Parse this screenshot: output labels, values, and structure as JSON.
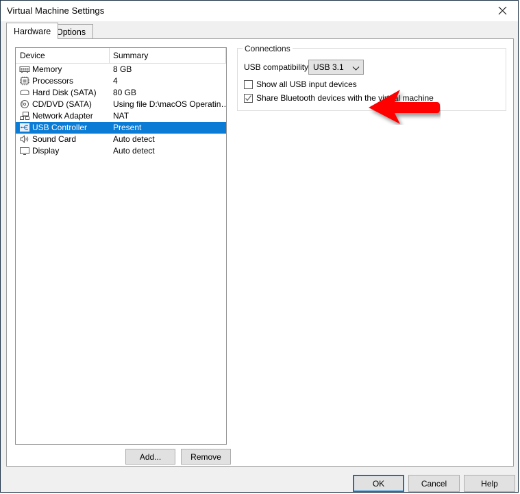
{
  "window": {
    "title": "Virtual Machine Settings",
    "close_icon": "close-icon"
  },
  "tabs": [
    {
      "label": "Hardware",
      "selected": true
    },
    {
      "label": "Options",
      "selected": false
    }
  ],
  "device_list": {
    "columns": [
      "Device",
      "Summary"
    ],
    "rows": [
      {
        "icon": "memory-icon",
        "name": "Memory",
        "summary": "8 GB",
        "selected": false
      },
      {
        "icon": "processor-icon",
        "name": "Processors",
        "summary": "4",
        "selected": false
      },
      {
        "icon": "hard-disk-icon",
        "name": "Hard Disk (SATA)",
        "summary": "80 GB",
        "selected": false
      },
      {
        "icon": "cd-dvd-icon",
        "name": "CD/DVD (SATA)",
        "summary": "Using file D:\\macOS Operatin…",
        "selected": false
      },
      {
        "icon": "network-adapter-icon",
        "name": "Network Adapter",
        "summary": "NAT",
        "selected": false
      },
      {
        "icon": "usb-controller-icon",
        "name": "USB Controller",
        "summary": "Present",
        "selected": true
      },
      {
        "icon": "sound-card-icon",
        "name": "Sound Card",
        "summary": "Auto detect",
        "selected": false
      },
      {
        "icon": "display-icon",
        "name": "Display",
        "summary": "Auto detect",
        "selected": false
      }
    ]
  },
  "list_buttons": {
    "add": "Add...",
    "remove": "Remove"
  },
  "connections": {
    "legend": "Connections",
    "usb_compatibility_label": "USB compatibility:",
    "usb_compatibility_value": "USB 3.1",
    "chevron_icon": "chevron-down-icon",
    "checkboxes": [
      {
        "label": "Show all USB input devices",
        "checked": false
      },
      {
        "label": "Share Bluetooth devices with the virtual machine",
        "checked": true
      }
    ]
  },
  "annotation": {
    "arrow_icon": "red-arrow-left-icon",
    "color": "#ff0000"
  },
  "dialog_buttons": {
    "ok": "OK",
    "cancel": "Cancel",
    "help": "Help"
  },
  "colors": {
    "selection": "#0a7cd5",
    "focus_border": "#0078d7",
    "window_border": "#1f3347",
    "button_face": "#e1e1e1"
  }
}
